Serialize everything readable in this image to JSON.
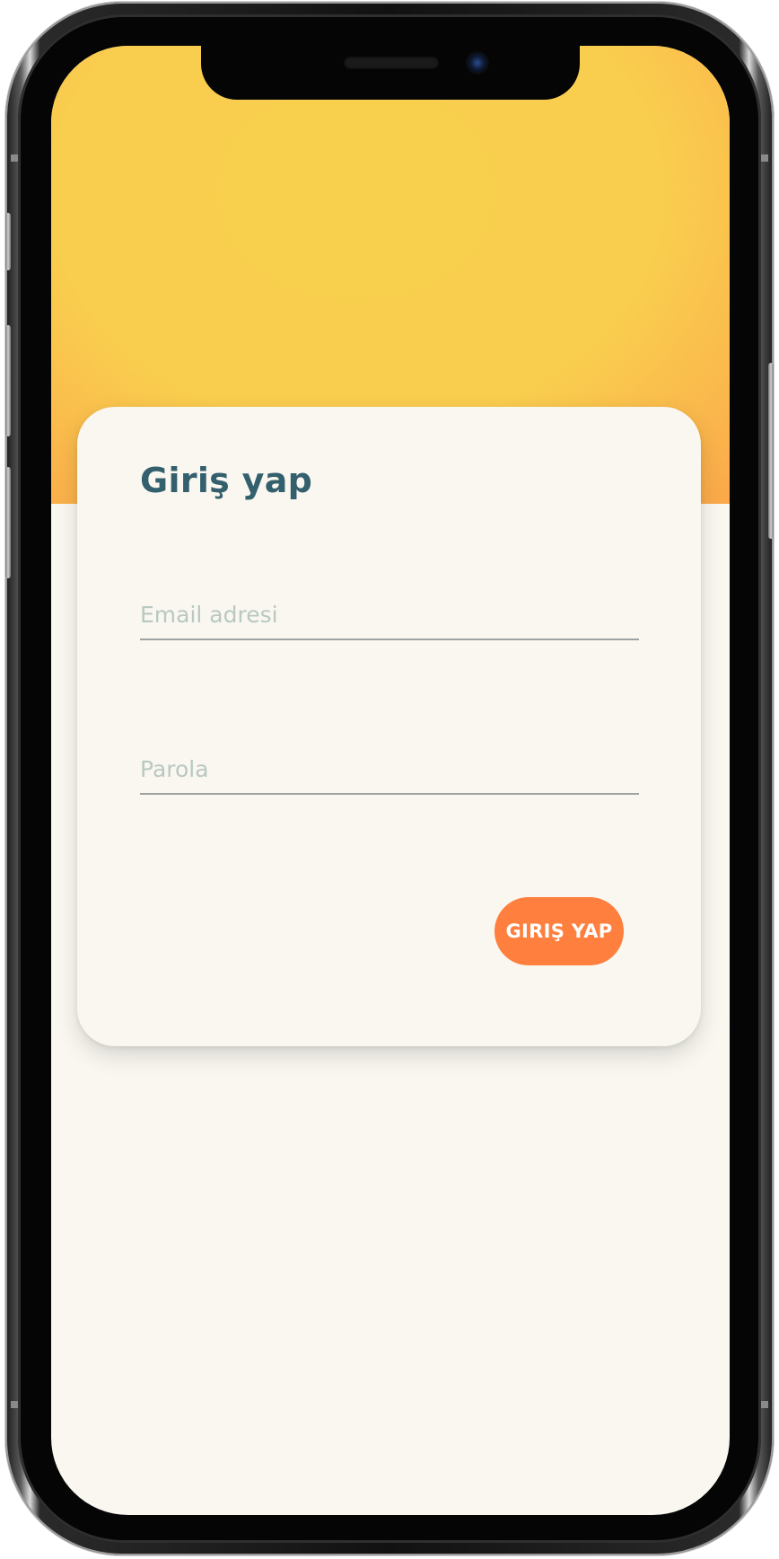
{
  "login": {
    "title": "Giriş yap",
    "email_placeholder": "Email adresi",
    "email_value": "",
    "password_placeholder": "Parola",
    "password_value": "",
    "submit_label": "GIRIŞ YAP"
  },
  "colors": {
    "accent": "#fe7f3e",
    "title": "#34606e",
    "hero_gradient_start": "#f9d04e",
    "hero_gradient_end": "#ff7d3e",
    "background": "#f9f7f0"
  }
}
